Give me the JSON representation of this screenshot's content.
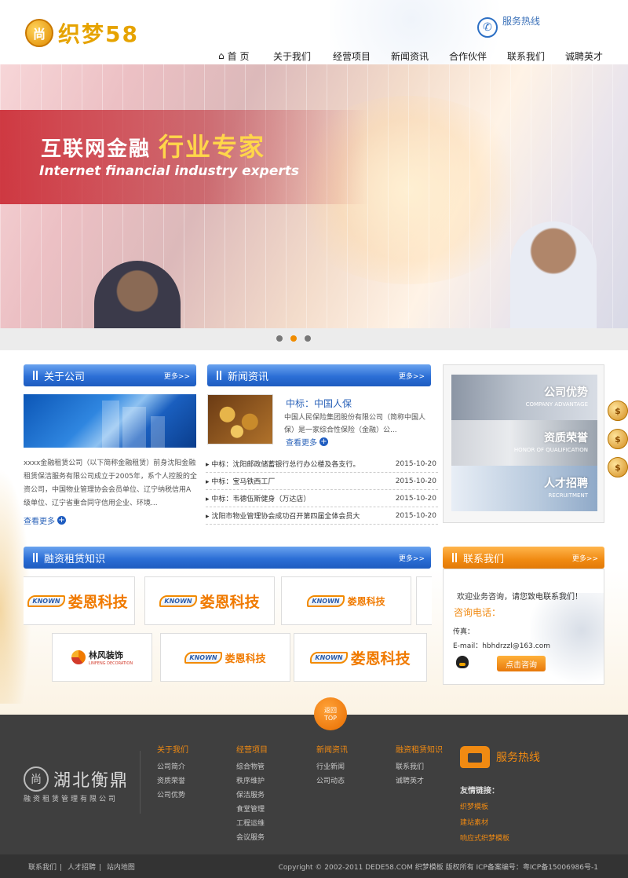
{
  "header": {
    "logo_badge": "尚",
    "logo_text": "织梦58",
    "hotline_label": "服务热线",
    "nav": [
      "首 页",
      "关于我们",
      "经营项目",
      "新闻资讯",
      "合作伙伴",
      "联系我们",
      "诚聘英才"
    ]
  },
  "banner": {
    "title_main": "互联网金融",
    "title_highlight": "行业专家",
    "subtitle": "Internet financial industry experts",
    "slides_count": 3,
    "active_slide": 2
  },
  "about": {
    "title": "关于公司",
    "more": "更多>>",
    "text": "xxxx金融租赁公司（以下简称金融租赁）前身沈阳金融租赁保洁服务有限公司成立于2005年，系个人控股的全资公司，中国物业管理协会会员单位、辽宁纳税信用A级单位、辽宁省重合同守信用企业、环境...",
    "view_more": "查看更多"
  },
  "news": {
    "title": "新闻资讯",
    "more": "更多>>",
    "feature_title": "中标：中国人保",
    "feature_desc": "中国人民保险集团股份有限公司（简称中国人保）是一家综合性保险（金融）公...",
    "view_more": "查看更多",
    "items": [
      {
        "title": "中标：沈阳邮政储蓄银行总行办公楼及各支行。",
        "date": "2015-10-20"
      },
      {
        "title": "中标：宝马铁西工厂",
        "date": "2015-10-20"
      },
      {
        "title": "中标：韦德伍斯健身（万达店）",
        "date": "2015-10-20"
      },
      {
        "title": "沈阳市物业管理协会成功召开第四届全体会员大",
        "date": "2015-10-20"
      }
    ]
  },
  "side": {
    "items": [
      {
        "cn": "公司优势",
        "en": "COMPANY ADVANTAGE"
      },
      {
        "cn": "资质荣誉",
        "en": "HONOR OF QUALIFICATION"
      },
      {
        "cn": "人才招聘",
        "en": "RECRUITMENT"
      }
    ],
    "coin_symbol": "$"
  },
  "knowledge": {
    "title": "融资租赁知识",
    "more": "更多>>",
    "partners": [
      {
        "badge": "KNOWN",
        "name": "娄恩科技"
      },
      {
        "badge": "KNOWN",
        "name": "娄恩科技"
      },
      {
        "badge": "KNOWN",
        "name": "娄恩科技"
      },
      {
        "name": "林风装饰",
        "sub": "LINFENG DECORATION"
      },
      {
        "badge": "KNOWN",
        "name": "娄恩科技"
      },
      {
        "badge": "KNOWN",
        "name": "娄恩科技"
      }
    ]
  },
  "contact": {
    "title": "联系我们",
    "more": "更多>>",
    "welcome": "欢迎业务咨询，请您致电联系我们！",
    "tel_label": "咨询电话：",
    "fax_label": "传真：",
    "email": "E-mail：hbhdrzzl@163.com",
    "consult_button": "点击咨询"
  },
  "back_to_top": {
    "line1": "返回",
    "line2": "TOP"
  },
  "footer": {
    "logo_badge": "尚",
    "company_name": "湖北衡鼎",
    "slogan": "融资租赁管理有限公司",
    "columns": [
      {
        "heading": "关于我们",
        "items": [
          "公司简介",
          "资质荣誉",
          "公司优势"
        ]
      },
      {
        "heading": "经营项目",
        "items": [
          "综合物管",
          "秩序维护",
          "保洁服务",
          "食堂管理",
          "工程运维",
          "会议服务"
        ]
      },
      {
        "heading": "新闻资讯",
        "items": [
          "行业新闻",
          "公司动态"
        ]
      },
      {
        "heading": "融资租赁知识",
        "items": [
          "联系我们",
          "诚聘英才"
        ]
      }
    ],
    "service_label": "服务热线",
    "friend_links_label": "友情链接：",
    "friend_links": [
      "织梦模板",
      "建站素材",
      "响应式织梦模板"
    ]
  },
  "bottom_bar": {
    "links": [
      "联系我们",
      "人才招聘",
      "站内地图"
    ],
    "copyright": "Copyright © 2002-2011 DEDE58.COM 织梦模板 版权所有  ICP备案编号：粤ICP备15006986号-1"
  },
  "colors": {
    "blue": "#2c6fd6",
    "orange": "#f08a12",
    "footer": "#3f3f3f"
  }
}
